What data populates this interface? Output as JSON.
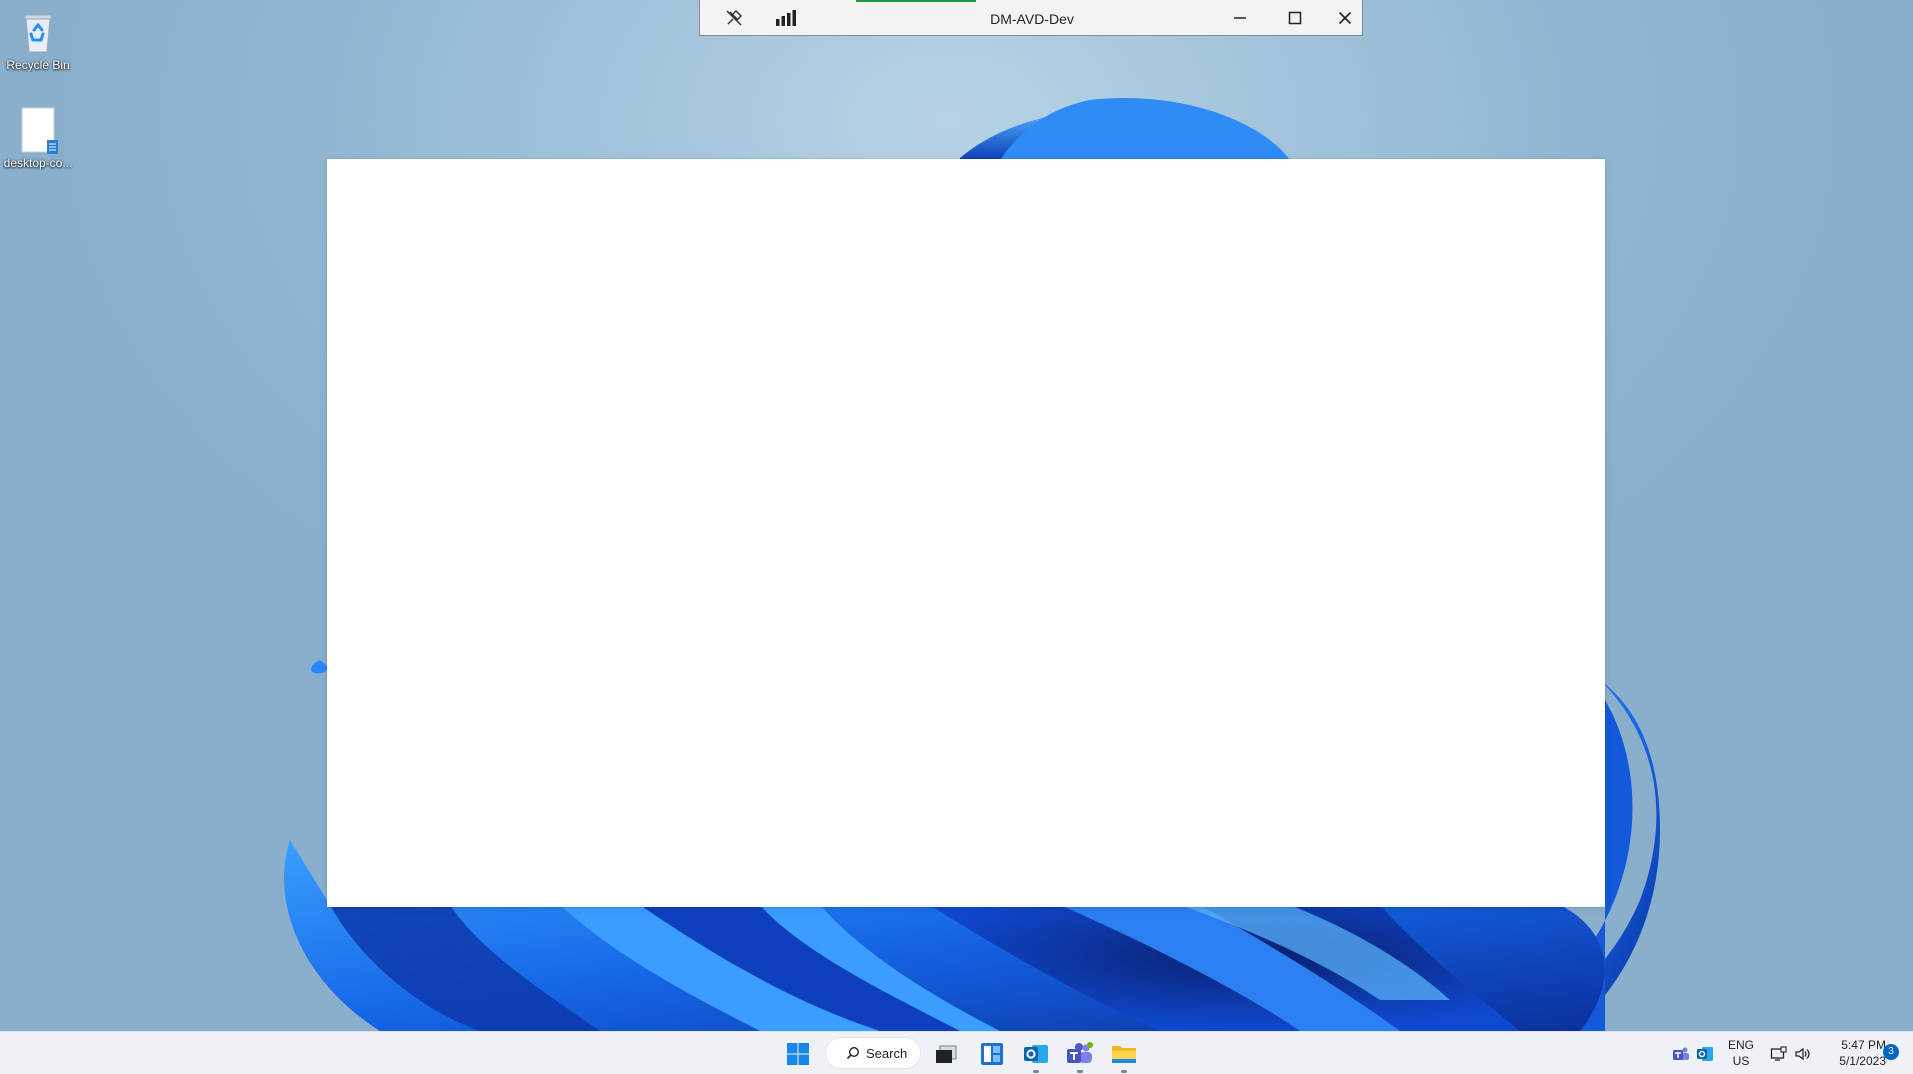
{
  "desktop": {
    "icons": [
      {
        "label": "Recycle Bin",
        "icon": "recycle-bin-icon"
      },
      {
        "label": "desktop-co...",
        "icon": "document-file-icon"
      }
    ]
  },
  "remote_session_bar": {
    "title": "DM-AVD-Dev",
    "pin_icon": "unpin-icon",
    "connection_icon": "signal-bars-icon",
    "minimize_icon": "minimize-icon",
    "restore_icon": "maximize-icon",
    "close_icon": "close-icon"
  },
  "taskbar": {
    "search_label": "Search",
    "pinned": [
      "start-icon",
      "task-view-icon",
      "widgets-icon",
      "outlook-icon",
      "teams-icon",
      "file-explorer-icon"
    ],
    "tray": {
      "language_top": "ENG",
      "language_bottom": "US",
      "time": "5:47 PM",
      "date": "5/1/2023",
      "notification_count": "3"
    }
  },
  "colors": {
    "wallpaper_bg": "#9ec0d9",
    "bloom_blue": "#1565e6",
    "taskbar_bg": "#eef2f7",
    "accent": "#0067c0"
  }
}
